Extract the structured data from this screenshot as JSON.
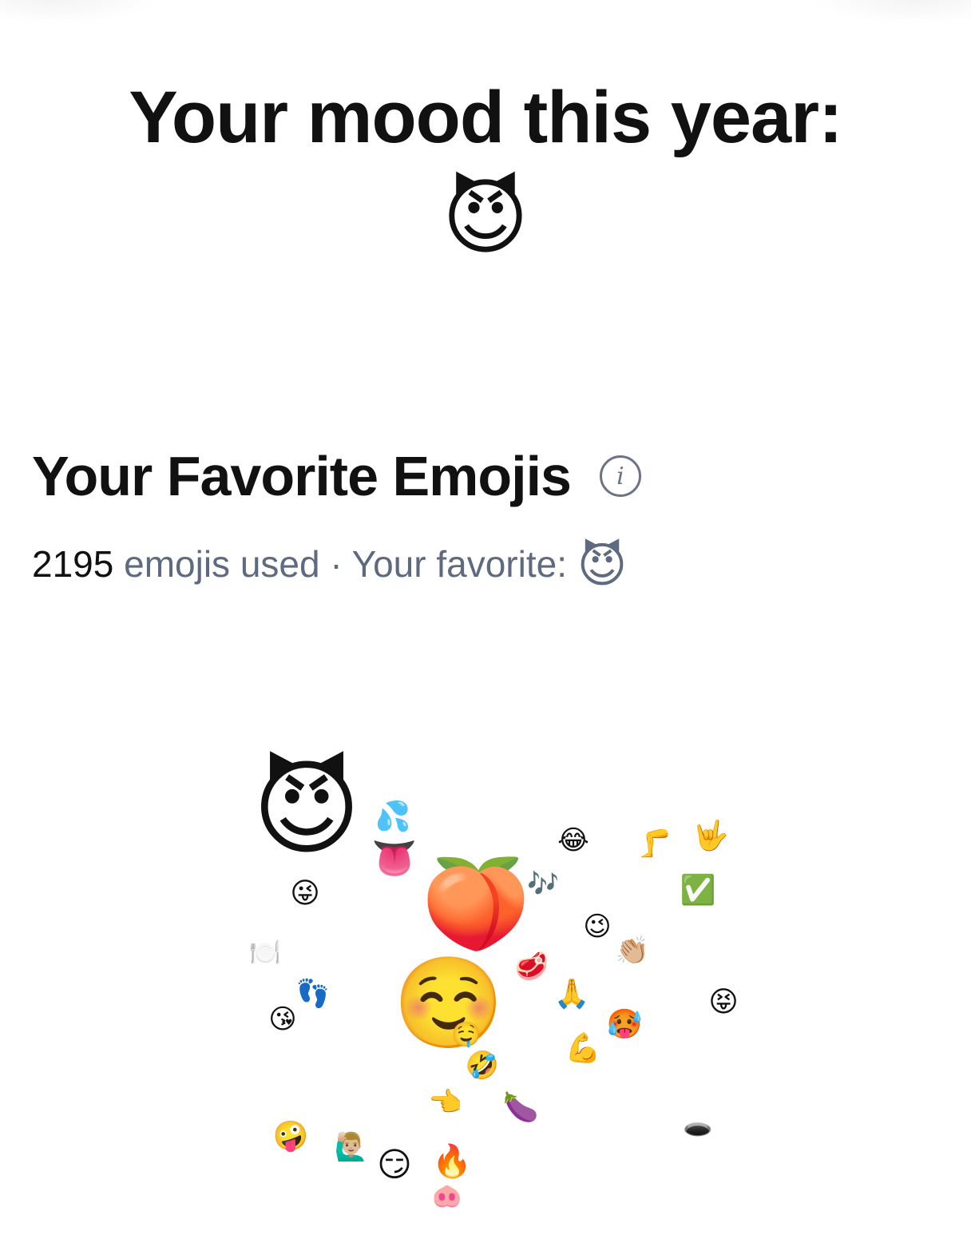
{
  "mood": {
    "title": "Your mood this year:",
    "emoji": "😈"
  },
  "favorites": {
    "title": "Your Favorite Emojis",
    "info_icon": "info-icon",
    "count": "2195",
    "used_text": " emojis used · Your favorite: ",
    "favorite_emoji": "😈"
  },
  "emoji_cloud": [
    {
      "emoji": "😈"
    },
    {
      "emoji": "💦"
    },
    {
      "emoji": "👅"
    },
    {
      "emoji": "😂"
    },
    {
      "emoji": "🦵"
    },
    {
      "emoji": "🤟"
    },
    {
      "emoji": "🍑"
    },
    {
      "emoji": "🎶"
    },
    {
      "emoji": "✅"
    },
    {
      "emoji": "😜"
    },
    {
      "emoji": "😉"
    },
    {
      "emoji": "👏🏼"
    },
    {
      "emoji": "🍽️"
    },
    {
      "emoji": "🥩"
    },
    {
      "emoji": "👣"
    },
    {
      "emoji": "☺️"
    },
    {
      "emoji": "🤤"
    },
    {
      "emoji": "🙏"
    },
    {
      "emoji": "😝"
    },
    {
      "emoji": "😘"
    },
    {
      "emoji": "🥵"
    },
    {
      "emoji": "💪"
    },
    {
      "emoji": "🤣"
    },
    {
      "emoji": "👈"
    },
    {
      "emoji": "🍆"
    },
    {
      "emoji": "🕳️"
    },
    {
      "emoji": "🤪"
    },
    {
      "emoji": "🙋🏼‍♂️"
    },
    {
      "emoji": "😏"
    },
    {
      "emoji": "🔥"
    },
    {
      "emoji": "🐽"
    }
  ]
}
